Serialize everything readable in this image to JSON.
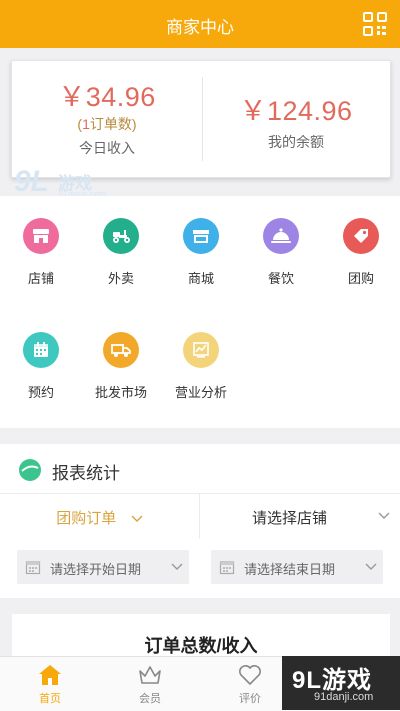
{
  "header": {
    "title": "商家中心"
  },
  "income": {
    "today_amount": "￥34.96",
    "today_orders_prefix": "(",
    "today_orders_num": "1",
    "today_orders_suffix": "订单数)",
    "today_label": "今日收入",
    "balance_amount": "￥124.96",
    "balance_label": "我的余额"
  },
  "watermark": {
    "brand": "9L",
    "game": "游戏",
    "url": "91danji.com"
  },
  "menu": {
    "items": [
      {
        "label": "店铺",
        "icon": "shop-icon",
        "color": "#ee6b9b"
      },
      {
        "label": "外卖",
        "icon": "delivery-scooter-icon",
        "color": "#23ae8c"
      },
      {
        "label": "商城",
        "icon": "store-icon",
        "color": "#3fb0e8"
      },
      {
        "label": "餐饮",
        "icon": "dining-cloche-icon",
        "color": "#9e84e5"
      },
      {
        "label": "团购",
        "icon": "tag-icon",
        "color": "#e85a57"
      },
      {
        "label": "预约",
        "icon": "calendar-icon",
        "color": "#3ec8c0"
      },
      {
        "label": "批发市场",
        "icon": "truck-icon",
        "color": "#f2a92a"
      },
      {
        "label": "营业分析",
        "icon": "analytics-chart-icon",
        "color": "#f3d47b"
      }
    ]
  },
  "report": {
    "title": "报表统计",
    "type_selected": "团购订单",
    "shop_placeholder": "请选择店铺",
    "start_date_placeholder": "请选择开始日期",
    "end_date_placeholder": "请选择结束日期",
    "total_title": "订单总数/收入"
  },
  "bottom_nav": {
    "items": [
      {
        "label": "首页",
        "icon": "home-icon",
        "active": true
      },
      {
        "label": "会员",
        "icon": "crown-icon",
        "active": false
      },
      {
        "label": "评价",
        "icon": "heart-icon",
        "active": false
      }
    ]
  },
  "corner_watermark": {
    "brand": "9L游戏",
    "url": "91danji.com"
  },
  "colors": {
    "accent": "#f7a90c",
    "amount": "#e26a5c",
    "type_label": "#d9a33d"
  }
}
